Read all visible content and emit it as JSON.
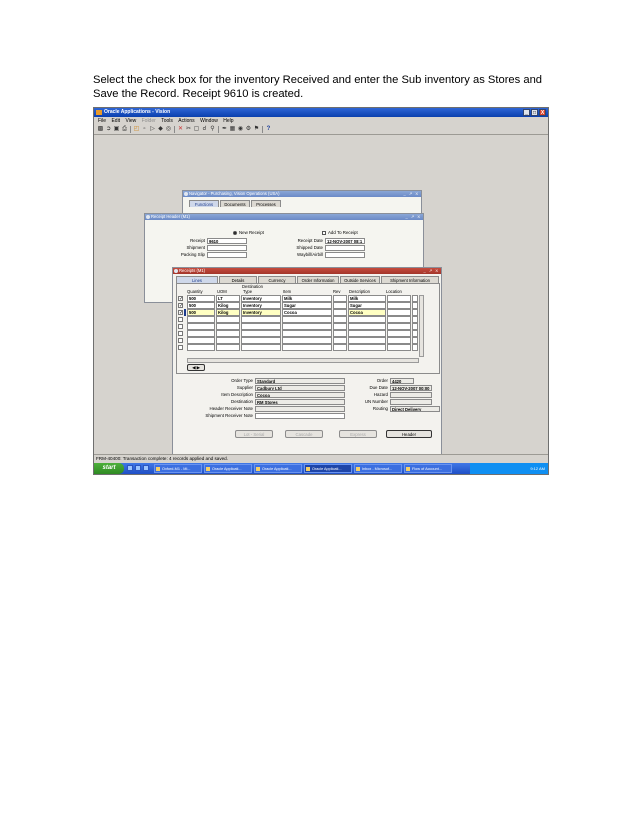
{
  "caption": "Select the check box for the inventory Received and enter the Sub inventory as Stores and Save the Record. Receipt 9610 is created.",
  "app": {
    "title": "Oracle Applications - Vision",
    "window_controls": [
      "_",
      "□",
      "X"
    ],
    "menu": [
      "File",
      "Edit",
      "View",
      "Folder",
      "Tools",
      "Actions",
      "Window",
      "Help"
    ]
  },
  "navigator": {
    "title": "Navigator - Purchasing, Vision Operations (USA)",
    "tabs": [
      "Functions",
      "Documents",
      "Processes"
    ]
  },
  "receipt_header": {
    "title": "Receipt Header (M1)",
    "new_receipt": "New Receipt",
    "add_to_receipt": "Add To Receipt",
    "receipt_label": "Receipt",
    "receipt_value": "9610",
    "shipment_label": "Shipment",
    "packing_slip_label": "Packing Slip",
    "receipt_date_label": "Receipt Date",
    "receipt_date_value": "12-NOV-2007 08:1",
    "shipped_date_label": "Shipped Date",
    "waybill_label": "Waybill/Airbill"
  },
  "receipts": {
    "title": "Receipts (M1)",
    "tabs": [
      "Lines",
      "Details",
      "Currency",
      "Order Information",
      "Outside Services",
      "Shipment Information"
    ],
    "destination_header": "Destination",
    "columns": [
      "Quantity",
      "UOM",
      "Type",
      "Item",
      "Rev",
      "Description",
      "Location"
    ],
    "rows": [
      {
        "quantity": "500",
        "uom": "LT",
        "type": "Inventory",
        "item": "Milk",
        "description": "Milk"
      },
      {
        "quantity": "500",
        "uom": "Kilog",
        "type": "Inventory",
        "item": "Sugar",
        "description": "Sugar"
      },
      {
        "quantity": "500",
        "uom": "Kilog",
        "type": "Inventory",
        "item": "Cocoa",
        "description": "Cocoa"
      }
    ],
    "order_type_label": "Order Type",
    "order_type_value": "Standard",
    "supplier_label": "Supplier",
    "supplier_value": "Cadbury Ltd",
    "item_description_label": "Item Description",
    "item_description_value": "Cocoa",
    "destination_label": "Destination",
    "destination_value": "RM Stores",
    "header_receiver_note_label": "Header Receiver Note",
    "shipment_receiver_note_label": "Shipment Receiver Note",
    "order_label": "Order",
    "order_value": "4420",
    "due_date_label": "Due Date",
    "due_date_value": "12-NOV-2007 00:00",
    "hazard_label": "Hazard",
    "un_number_label": "UN Number",
    "routing_label": "Routing",
    "routing_value": "Direct Delivery",
    "buttons": [
      "Lot - Serial",
      "Cascade",
      "Express",
      "Header"
    ]
  },
  "status_bar": "FRM-40400: Transaction complete: 4 records applied and saved.",
  "taskbar": {
    "start": "start",
    "tasks": [
      "Oxford-M1 - Mi...",
      "Oracle Applicati...",
      "Oracle Applicati...",
      "Oracle Applicati...",
      "Inbox - Microsof...",
      "Flow of Account..."
    ],
    "clock": "9:12 AM"
  },
  "colors": {
    "title_bar": "#0a3fae",
    "active_window": "#a3352a",
    "inactive_window": "#6b8ac7",
    "required_field": "#ffffc2",
    "taskbar": "#1f4fc6",
    "start_button": "#2f8a23"
  }
}
